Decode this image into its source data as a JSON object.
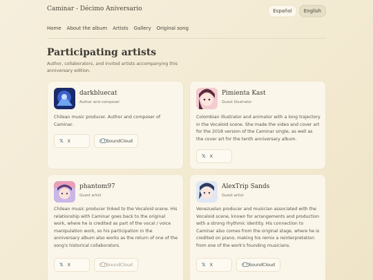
{
  "header": {
    "site_title": "Caminar - Décimo Aniversario",
    "languages": [
      "Español",
      "English"
    ],
    "active_language": "English"
  },
  "nav": {
    "items": [
      "Home",
      "About the album",
      "Artists",
      "Gallery",
      "Original song"
    ]
  },
  "page": {
    "title": "Participating artists",
    "subtitle": "Author, collaborators, and invited artists accompanying this anniversary edition."
  },
  "artists": [
    {
      "name": "darkbluecat",
      "role": "Author and composer",
      "bio": "Chilean music producer. Author and composer of Caminar.",
      "links": [
        {
          "label": "X",
          "icon": "x-icon",
          "enabled": true
        },
        {
          "label": "SoundCloud",
          "icon": "cloud-icon",
          "enabled": true
        }
      ]
    },
    {
      "name": "Pimienta Kast",
      "role": "Guest illustrator",
      "bio": "Colombian illustrator and animator with a long trajectory in the Vocaloid scene. She made the video and cover art for the 2018 version of the Caminar single, as well as the cover art for the tenth anniversary album.",
      "links": [
        {
          "label": "X",
          "icon": "x-icon",
          "enabled": true
        }
      ]
    },
    {
      "name": "phantom97",
      "role": "Guest artist",
      "bio": "Chilean music producer linked to the Vocaloid scene. His relationship with Caminar goes back to the original work, where he is credited as part of the vocal / voice manipulation work, so his participation in the anniversary album also works as the return of one of the song's historical collaborators.",
      "links": [
        {
          "label": "X",
          "icon": "x-icon",
          "enabled": true
        },
        {
          "label": "SoundCloud",
          "icon": "cloud-icon",
          "enabled": false
        }
      ]
    },
    {
      "name": "AlexTrip Sands",
      "role": "Guest artist",
      "bio": "Venezuelan producer and musician associated with the Vocaloid scene, known for arrangements and production with a strong rhythmic identity. His connection to Caminar also comes from the original stage, where he is credited on piano, making his remix a reinterpretation from one of the work's founding musicians.",
      "links": [
        {
          "label": "X",
          "icon": "x-icon",
          "enabled": true
        },
        {
          "label": "SoundCloud",
          "icon": "cloud-icon",
          "enabled": true
        }
      ]
    }
  ]
}
